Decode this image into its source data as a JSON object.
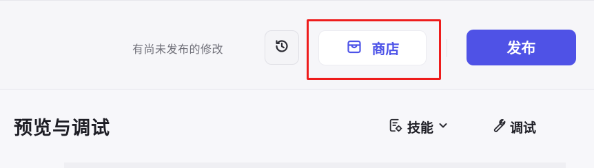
{
  "header": {
    "unpublished_text": "有尚未发布的修改",
    "history_icon": "history-clock-icon",
    "store_label": "商店",
    "store_icon": "store-icon",
    "publish_label": "发布",
    "accent_color": "#4d53e8",
    "highlight_color": "#ee1c1c"
  },
  "panel": {
    "title": "预览与调试",
    "tabs": [
      {
        "label": "技能",
        "icon": "skill-doc-icon",
        "dropdown": true
      },
      {
        "label": "调试",
        "icon": "wrench-icon",
        "dropdown": false
      }
    ]
  }
}
